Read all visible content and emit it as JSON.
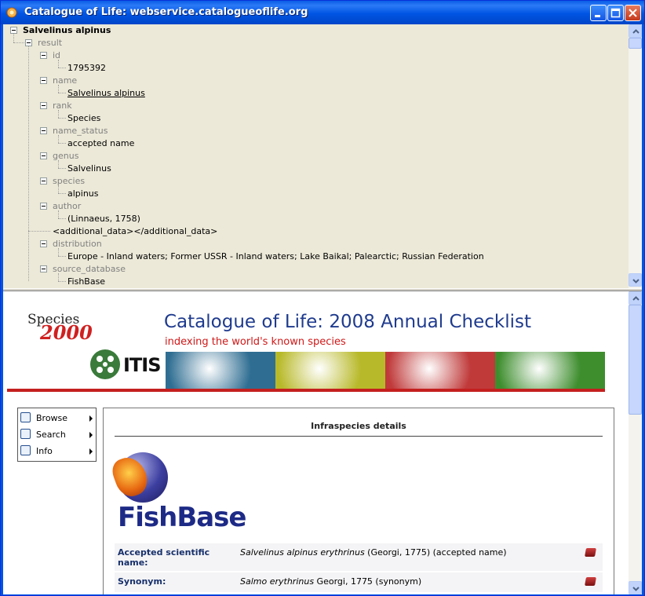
{
  "window": {
    "title": "Catalogue of Life: webservice.catalogueoflife.org"
  },
  "tree": {
    "root": "Salvelinus alpinus",
    "result": "result",
    "fields": [
      {
        "key": "id",
        "value": "1795392",
        "link": false
      },
      {
        "key": "name",
        "value": "Salvelinus alpinus",
        "link": true
      },
      {
        "key": "rank",
        "value": "Species",
        "link": false
      },
      {
        "key": "name_status",
        "value": "accepted name",
        "link": false
      },
      {
        "key": "genus",
        "value": "Salvelinus",
        "link": false
      },
      {
        "key": "species",
        "value": "alpinus",
        "link": false
      },
      {
        "key": "author",
        "value": "(Linnaeus, 1758)",
        "link": false
      }
    ],
    "additional_data": "<additional_data></additional_data>",
    "fields2": [
      {
        "key": "distribution",
        "value": "Europe - Inland waters; Former USSR - Inland waters; Lake Baikal; Palearctic; Russian Federation"
      },
      {
        "key": "source_database",
        "value": "FishBase"
      }
    ]
  },
  "banner": {
    "species_word": "Species",
    "species_year": "2000",
    "itis": "ITIS",
    "title": "Catalogue of Life: 2008 Annual Checklist",
    "tagline": "indexing the world's known species",
    "photo_colors": [
      "#2f6e92",
      "#b8b92a",
      "#c03a3a",
      "#3e8e2e"
    ]
  },
  "menu": {
    "items": [
      {
        "label": "Browse",
        "icon": "page-icon"
      },
      {
        "label": "Search",
        "icon": "magnifier-icon"
      },
      {
        "label": "Info",
        "icon": "question-icon"
      }
    ]
  },
  "content": {
    "section_title": "Infraspecies details",
    "logo_text": "FishBase",
    "rows": [
      {
        "label": "Accepted scientific name:",
        "name": "Salvelinus alpinus erythrinus",
        "rest": " (Georgi, 1775) (accepted name)"
      },
      {
        "label": "Synonym:",
        "name": "Salmo erythrinus",
        "rest": " Georgi, 1775 (synonym)"
      }
    ]
  },
  "colors": {
    "title_blue": "#1f3b8e",
    "tag_red": "#d01818",
    "tree_bg": "#ece9d8"
  }
}
